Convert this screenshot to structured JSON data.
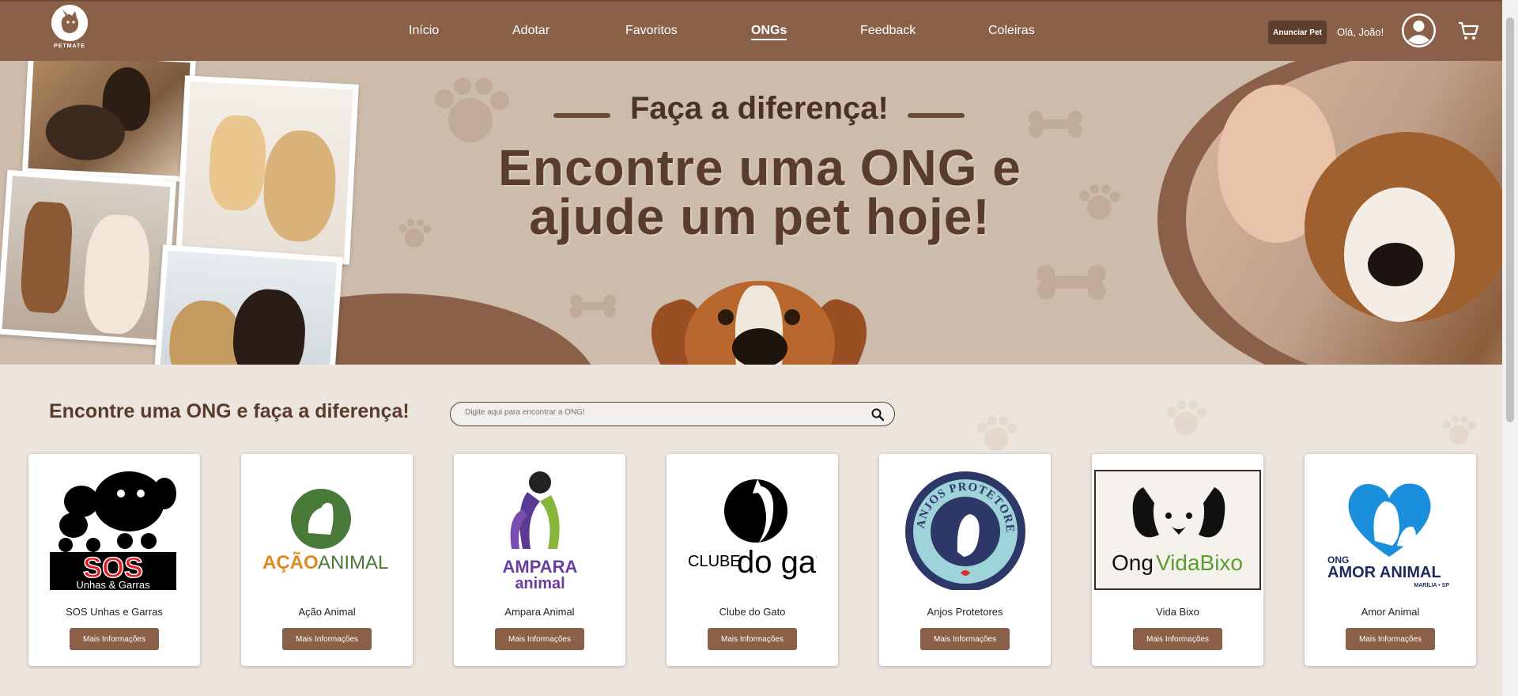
{
  "header": {
    "brand": "PETMATE",
    "nav": [
      "Início",
      "Adotar",
      "Favoritos",
      "ONGs",
      "Feedback",
      "Coleiras"
    ],
    "active_nav": "ONGs",
    "announce_label": "Anunciar Pet",
    "greeting": "Olá, João!"
  },
  "hero": {
    "tagline": "Faça a diferença!",
    "headline_line1": "Encontre uma ONG e",
    "headline_line2": "ajude um pet hoje!"
  },
  "section": {
    "title": "Encontre uma ONG e faça a diferença!",
    "search_placeholder": "Digite aqui para encontrar a ONG!"
  },
  "ngos": [
    {
      "name": "SOS Unhas e Garras",
      "logo_text": "SOS",
      "logo_sub": "Unhas & Garras",
      "button": "Mais Informações"
    },
    {
      "name": "Ação Animal",
      "logo_text": "AÇÃO",
      "logo_sub": "ANIMAL",
      "button": "Mais Informações"
    },
    {
      "name": "Ampara Animal",
      "logo_text": "AMPARA",
      "logo_sub": "animal",
      "button": "Mais Informações"
    },
    {
      "name": "Clube do Gato",
      "logo_text": "CLUBE",
      "logo_sub": "do gato",
      "button": "Mais Informações"
    },
    {
      "name": "Anjos Protetores",
      "logo_text": "ANJOS PROTETORES",
      "logo_sub": "",
      "button": "Mais Informações"
    },
    {
      "name": "Vida Bixo",
      "logo_text": "Ong",
      "logo_sub": "VidaBixo",
      "button": "Mais Informações"
    },
    {
      "name": "Amor Animal",
      "logo_text": "ONG",
      "logo_sub": "AMOR ANIMAL",
      "logo_small": "MARÍLIA • SP",
      "button": "Mais Informações"
    }
  ],
  "colors": {
    "header": "#8a6048",
    "hero": "#cdbcac",
    "accent": "#5a3c2c",
    "background": "#ece5dd"
  }
}
